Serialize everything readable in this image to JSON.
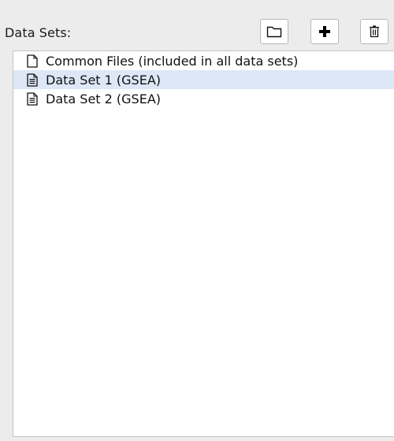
{
  "panel": {
    "title": "Data Sets:"
  },
  "toolbar": {
    "buttons": [
      {
        "name": "new-folder-button",
        "icon": "folder-icon"
      },
      {
        "name": "add-button",
        "icon": "plus-icon"
      },
      {
        "name": "delete-button",
        "icon": "trash-icon"
      }
    ]
  },
  "data_sets": {
    "items": [
      {
        "label": "Common Files (included in all data sets)",
        "icon": "blank-file-icon",
        "selected": false
      },
      {
        "label": "Data Set 1  (GSEA)",
        "icon": "text-file-icon",
        "selected": true
      },
      {
        "label": "Data Set 2  (GSEA)",
        "icon": "text-file-icon",
        "selected": false
      }
    ]
  },
  "colors": {
    "selection": "#dde7f6",
    "panel_background": "#ececec",
    "list_background": "#ffffff"
  }
}
